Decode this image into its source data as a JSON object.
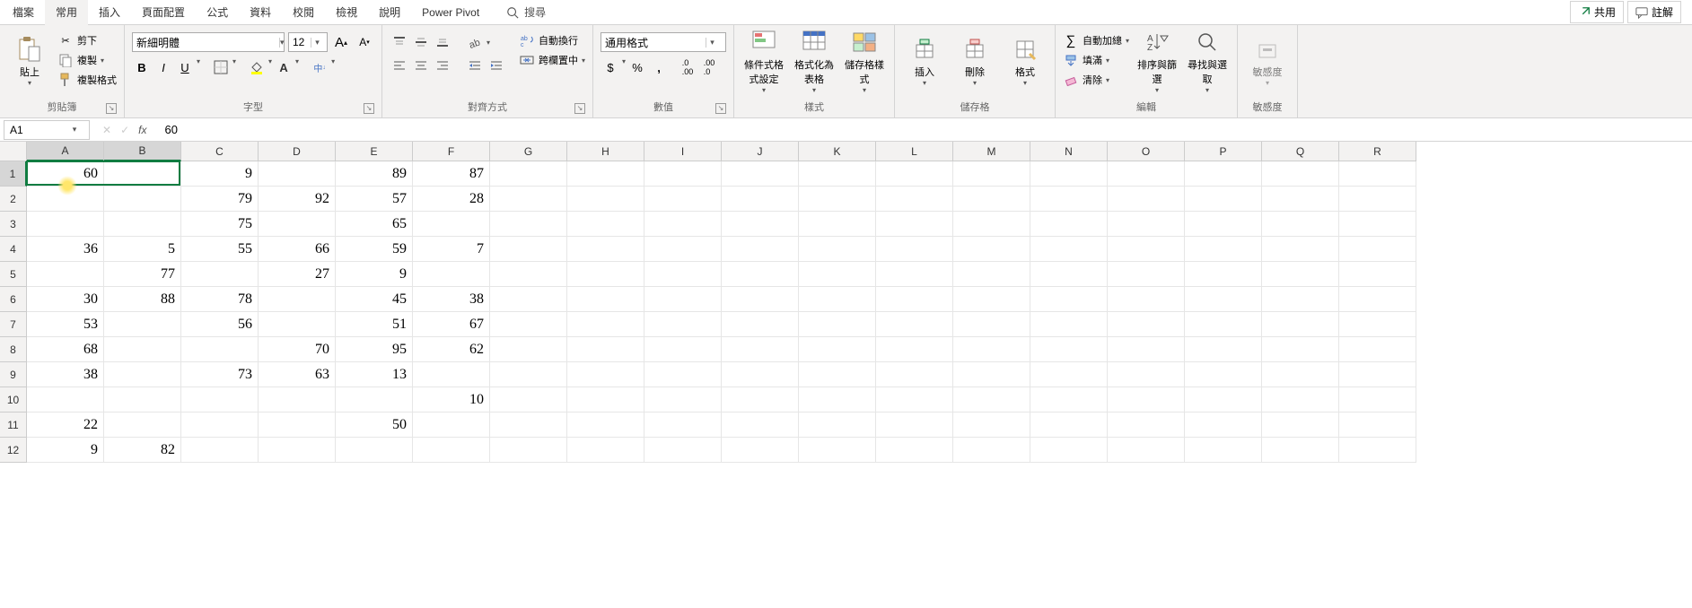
{
  "menu": {
    "items": [
      "檔案",
      "常用",
      "插入",
      "頁面配置",
      "公式",
      "資料",
      "校閱",
      "檢視",
      "說明",
      "Power Pivot"
    ],
    "active_index": 1,
    "search_placeholder": "搜尋",
    "share": "共用",
    "comments": "註解"
  },
  "ribbon": {
    "clipboard": {
      "paste": "貼上",
      "cut": "剪下",
      "copy": "複製",
      "formatpainter": "複製格式",
      "label": "剪貼簿"
    },
    "font": {
      "name": "新細明體",
      "size": "12",
      "label": "字型"
    },
    "align": {
      "wrap": "自動換行",
      "merge": "跨欄置中",
      "label": "對齊方式"
    },
    "number": {
      "format": "通用格式",
      "label": "數值"
    },
    "styles": {
      "cond": "條件式格式設定",
      "table": "格式化為表格",
      "cell": "儲存格樣式",
      "label": "樣式"
    },
    "cells": {
      "insert": "插入",
      "delete": "刪除",
      "format": "格式",
      "label": "儲存格"
    },
    "editing": {
      "sum": "自動加總",
      "fill": "填滿",
      "clear": "清除",
      "sort": "排序與篩選",
      "find": "尋找與選取",
      "label": "編輯"
    },
    "sensitivity": {
      "btn": "敏感度",
      "label": "敏感度"
    }
  },
  "formula": {
    "name": "A1",
    "value": "60"
  },
  "grid": {
    "cols": [
      "A",
      "B",
      "C",
      "D",
      "E",
      "F",
      "G",
      "H",
      "I",
      "J",
      "K",
      "L",
      "M",
      "N",
      "O",
      "P",
      "Q",
      "R"
    ],
    "row_count": 12,
    "selected_col": 0,
    "selected_row": 0,
    "selection_span_cols": 2,
    "data": [
      [
        "60",
        "",
        "9",
        "",
        "89",
        "87"
      ],
      [
        "",
        "",
        "79",
        "92",
        "57",
        "28"
      ],
      [
        "",
        "",
        "75",
        "",
        "65",
        ""
      ],
      [
        "36",
        "5",
        "55",
        "66",
        "59",
        "7"
      ],
      [
        "",
        "77",
        "",
        "27",
        "9",
        ""
      ],
      [
        "30",
        "88",
        "78",
        "",
        "45",
        "38"
      ],
      [
        "53",
        "",
        "56",
        "",
        "51",
        "67"
      ],
      [
        "68",
        "",
        "",
        "70",
        "95",
        "62"
      ],
      [
        "38",
        "",
        "73",
        "63",
        "13",
        ""
      ],
      [
        "",
        "",
        "",
        "",
        "",
        "10"
      ],
      [
        "22",
        "",
        "",
        "",
        "50",
        ""
      ],
      [
        "9",
        "82",
        "",
        "",
        "",
        ""
      ]
    ]
  },
  "colors": {
    "accent": "#107c41"
  }
}
